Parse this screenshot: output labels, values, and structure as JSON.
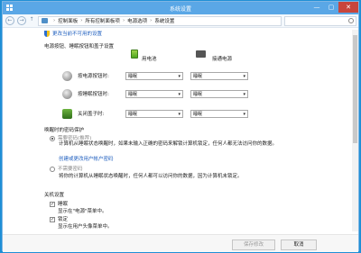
{
  "window": {
    "title": "系统设置",
    "min": "—",
    "max": "▢",
    "close": "✕"
  },
  "address": {
    "back": "←",
    "forward": "→",
    "up": "↑",
    "crumbs": [
      "控制面板",
      "所有控制面板项",
      "电源选项",
      "系统设置"
    ],
    "separator": "›"
  },
  "change_link": "更改当前不可用的设置",
  "power_section": {
    "title": "电源按钮、睡眠按钮和盖子设置",
    "col_battery": "用电池",
    "col_plugged": "接通电源",
    "rows": [
      {
        "label": "按电源按钮时:",
        "battery": "睡眠",
        "plugged": "睡眠"
      },
      {
        "label": "按睡眠按钮时:",
        "battery": "睡眠",
        "plugged": "睡眠"
      },
      {
        "label": "关闭盖子时:",
        "battery": "睡眠",
        "plugged": "睡眠"
      }
    ]
  },
  "password_section": {
    "title": "唤醒时的密码保护",
    "opt1_title": "需要密码(推荐)",
    "opt1_desc": "计算机从睡眠状态唤醒时，如果未输入正确的密码来解锁计算机锁定，任何人都无法访问你的数据。",
    "opt1_link": "创建或更改用户帐户密码",
    "opt2_title": "不需要密码",
    "opt2_desc": "将你的计算机从睡眠状态唤醒时，任何人都可以访问你的数据，因为计算机未锁定。"
  },
  "shutdown_section": {
    "title": "关机设置",
    "sleep_title": "睡眠",
    "sleep_desc": "显示在\"电源\"菜单中。",
    "lock_title": "锁定",
    "lock_desc": "显示在用户头像菜单中。"
  },
  "buttons": {
    "save": "保存修改",
    "cancel": "取消"
  },
  "colors": {
    "titlebar": "#5aa7e6",
    "desktop": "#1f8fd6",
    "link": "#1f5fbf"
  }
}
